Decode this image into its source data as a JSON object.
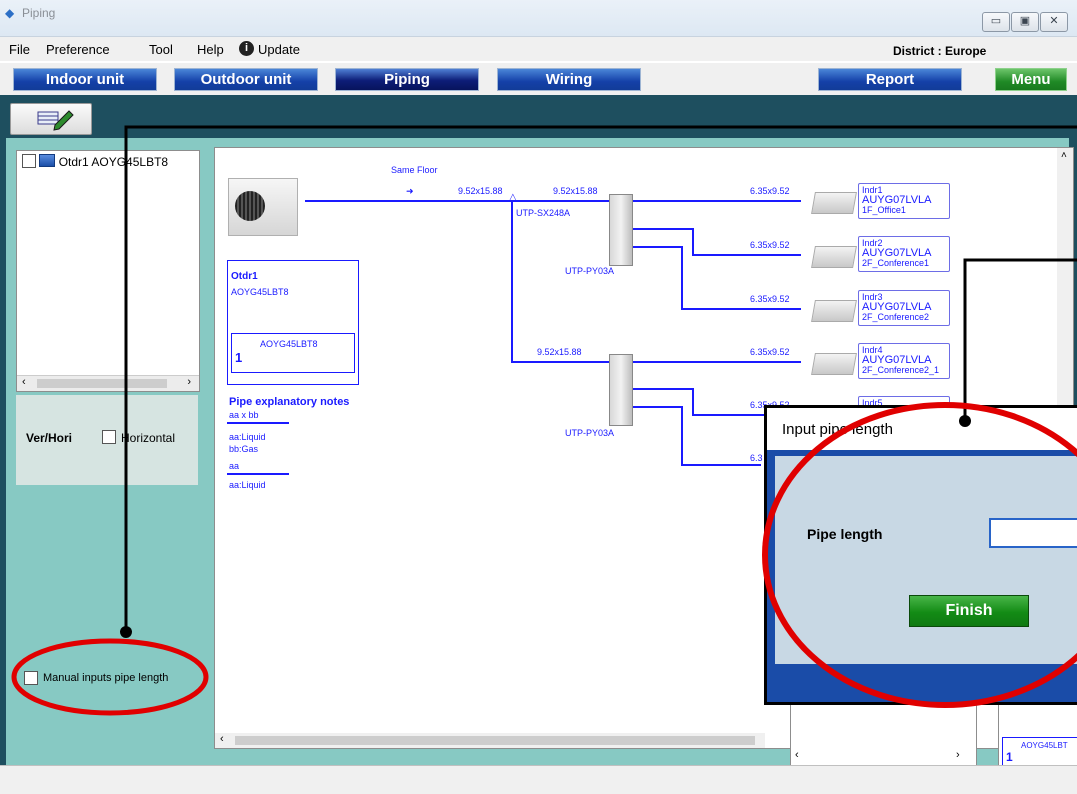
{
  "window": {
    "title": "Piping"
  },
  "menubar": {
    "items": [
      "File",
      "Preference",
      "Tool",
      "Help",
      "Update"
    ],
    "district": "District : Europe"
  },
  "nav": {
    "indoor": "Indoor unit",
    "outdoor": "Outdoor unit",
    "piping": "Piping",
    "wiring": "Wiring",
    "report": "Report",
    "menu": "Menu"
  },
  "tree": {
    "item": "Otdr1 AOYG45LBT8"
  },
  "orientation": {
    "label": "Ver/Hori",
    "checkbox_label": "Horizontal"
  },
  "manual_inputs": {
    "label": "Manual inputs pipe length"
  },
  "diagram": {
    "same_floor": "Same Floor",
    "outdoor_name": "Otdr1",
    "outdoor_model": "AOYG45LBT8",
    "outdoor_sub_model": "AOYG45LBT8",
    "outdoor_count": "1",
    "notes_title": "Pipe explanatory notes",
    "notes_lines": [
      "aa x bb",
      "aa:Liquid",
      "bb:Gas",
      "aa",
      "aa:Liquid"
    ],
    "main_pipe_1": "9.52x15.88",
    "main_pipe_2": "9.52x15.88",
    "main_pipe_3": "9.52x15.88",
    "separator_main": "UTP-SX248A",
    "separator_1": "UTP-PY03A",
    "separator_2": "UTP-PY03A",
    "branch_pipes": [
      "6.35x9.52",
      "6.35x9.52",
      "6.35x9.52",
      "6.35x9.52",
      "6.35x9.52",
      "6.3"
    ],
    "indoor_units": [
      {
        "name": "Indr1",
        "model": "AUYG07LVLA",
        "room": "1F_Office1"
      },
      {
        "name": "Indr2",
        "model": "AUYG07LVLA",
        "room": "2F_Conference1"
      },
      {
        "name": "Indr3",
        "model": "AUYG07LVLA",
        "room": "2F_Conference2"
      },
      {
        "name": "Indr4",
        "model": "AUYG07LVLA",
        "room": "2F_Conference2_1"
      },
      {
        "name": "Indr5",
        "model": "",
        "room": ""
      }
    ],
    "bottom_right_model": "AOYG45LBT",
    "bottom_right_count": "1"
  },
  "dialog": {
    "title": "Input pipe length",
    "field_label": "Pipe length",
    "field_value": "",
    "finish": "Finish"
  },
  "colors": {
    "pipe": "#1a1aff",
    "highlight": "#ff0000",
    "nav": "#1440a8",
    "menu": "#208a26"
  }
}
